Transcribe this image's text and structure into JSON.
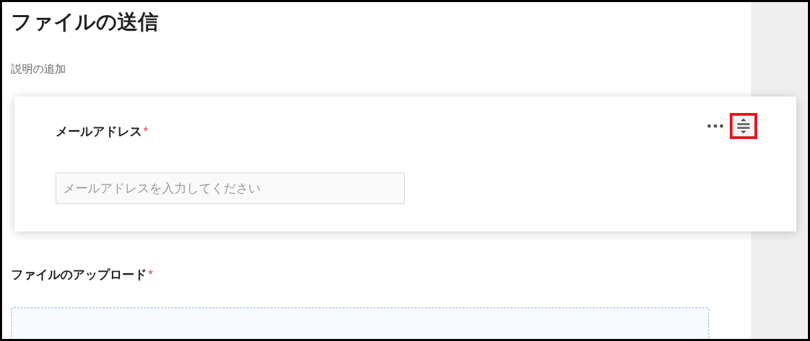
{
  "title": "ファイルの送信",
  "description": "説明の追加",
  "fields": [
    {
      "kind": "text",
      "label": "メールアドレス",
      "required_mark": "*",
      "placeholder": "メールアドレスを入力してください",
      "selected": true,
      "handle_highlighted": true
    },
    {
      "kind": "upload",
      "label": "ファイルのアップロード",
      "required_mark": "*",
      "selected": false
    }
  ]
}
